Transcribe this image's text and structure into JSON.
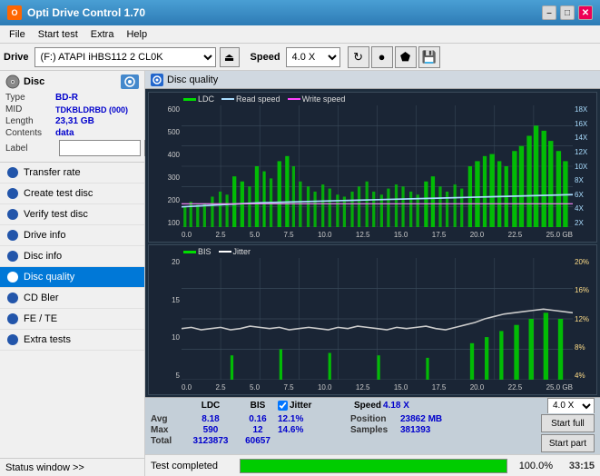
{
  "app": {
    "title": "Opti Drive Control 1.70",
    "icon_label": "O"
  },
  "titlebar_buttons": {
    "minimize": "–",
    "maximize": "□",
    "close": "✕"
  },
  "menubar": {
    "items": [
      "File",
      "Start test",
      "Extra",
      "Help"
    ]
  },
  "drivebar": {
    "label": "Drive",
    "drive_value": "(F:)  ATAPI iHBS112  2 CL0K",
    "speed_label": "Speed",
    "speed_value": "4.0 X",
    "eject_icon": "⏏",
    "icons": [
      "🔄",
      "💿",
      "🔒",
      "💾"
    ]
  },
  "disc": {
    "header": "Disc",
    "type_label": "Type",
    "type_value": "BD-R",
    "mid_label": "MID",
    "mid_value": "TDKBLDRBD (000)",
    "length_label": "Length",
    "length_value": "23,31 GB",
    "contents_label": "Contents",
    "contents_value": "data",
    "label_label": "Label",
    "label_placeholder": ""
  },
  "nav": {
    "items": [
      {
        "id": "transfer-rate",
        "label": "Transfer rate",
        "active": false
      },
      {
        "id": "create-test-disc",
        "label": "Create test disc",
        "active": false
      },
      {
        "id": "verify-test-disc",
        "label": "Verify test disc",
        "active": false
      },
      {
        "id": "drive-info",
        "label": "Drive info",
        "active": false
      },
      {
        "id": "disc-info",
        "label": "Disc info",
        "active": false
      },
      {
        "id": "disc-quality",
        "label": "Disc quality",
        "active": true
      },
      {
        "id": "cd-bler",
        "label": "CD Bler",
        "active": false
      },
      {
        "id": "fe-te",
        "label": "FE / TE",
        "active": false
      },
      {
        "id": "extra-tests",
        "label": "Extra tests",
        "active": false
      }
    ]
  },
  "status_window": {
    "label": "Status window >>",
    "completed": "Test completed"
  },
  "disc_quality": {
    "header": "Disc quality",
    "legend": {
      "ldc": "LDC",
      "read_speed": "Read speed",
      "write_speed": "Write speed",
      "bis": "BIS",
      "jitter": "Jitter"
    }
  },
  "stats": {
    "headers": {
      "ldc": "LDC",
      "bis": "BIS",
      "jitter": "Jitter",
      "speed": "Speed",
      "position": "Position",
      "samples": "Samples"
    },
    "avg_label": "Avg",
    "max_label": "Max",
    "total_label": "Total",
    "avg_ldc": "8.18",
    "avg_bis": "0.16",
    "avg_jitter": "12.1%",
    "max_ldc": "590",
    "max_bis": "12",
    "max_jitter": "14.6%",
    "total_ldc": "3123873",
    "total_bis": "60657",
    "speed_val": "4.18 X",
    "position_val": "23862 MB",
    "samples_val": "381393",
    "speed_select": "4.0 X",
    "start_full": "Start full",
    "start_part": "Start part",
    "jitter_check": true
  },
  "progress": {
    "percent": 100,
    "label": "100.0%",
    "time": "33:15",
    "bar_color": "#00cc00"
  },
  "chart1": {
    "y_max": 600,
    "y_labels": [
      "600",
      "500",
      "400",
      "300",
      "200",
      "100"
    ],
    "y_right_labels": [
      "18X",
      "16X",
      "14X",
      "12X",
      "10X",
      "8X",
      "6X",
      "4X",
      "2X"
    ],
    "x_labels": [
      "0.0",
      "2.5",
      "5.0",
      "7.5",
      "10.0",
      "12.5",
      "15.0",
      "17.5",
      "20.0",
      "22.5",
      "25.0"
    ]
  },
  "chart2": {
    "y_max": 20,
    "y_labels": [
      "20",
      "15",
      "10",
      "5"
    ],
    "y_right_labels": [
      "20%",
      "16%",
      "12%",
      "8%",
      "4%"
    ],
    "x_labels": [
      "0.0",
      "2.5",
      "5.0",
      "7.5",
      "10.0",
      "12.5",
      "15.0",
      "17.5",
      "20.0",
      "22.5",
      "25.0"
    ]
  }
}
